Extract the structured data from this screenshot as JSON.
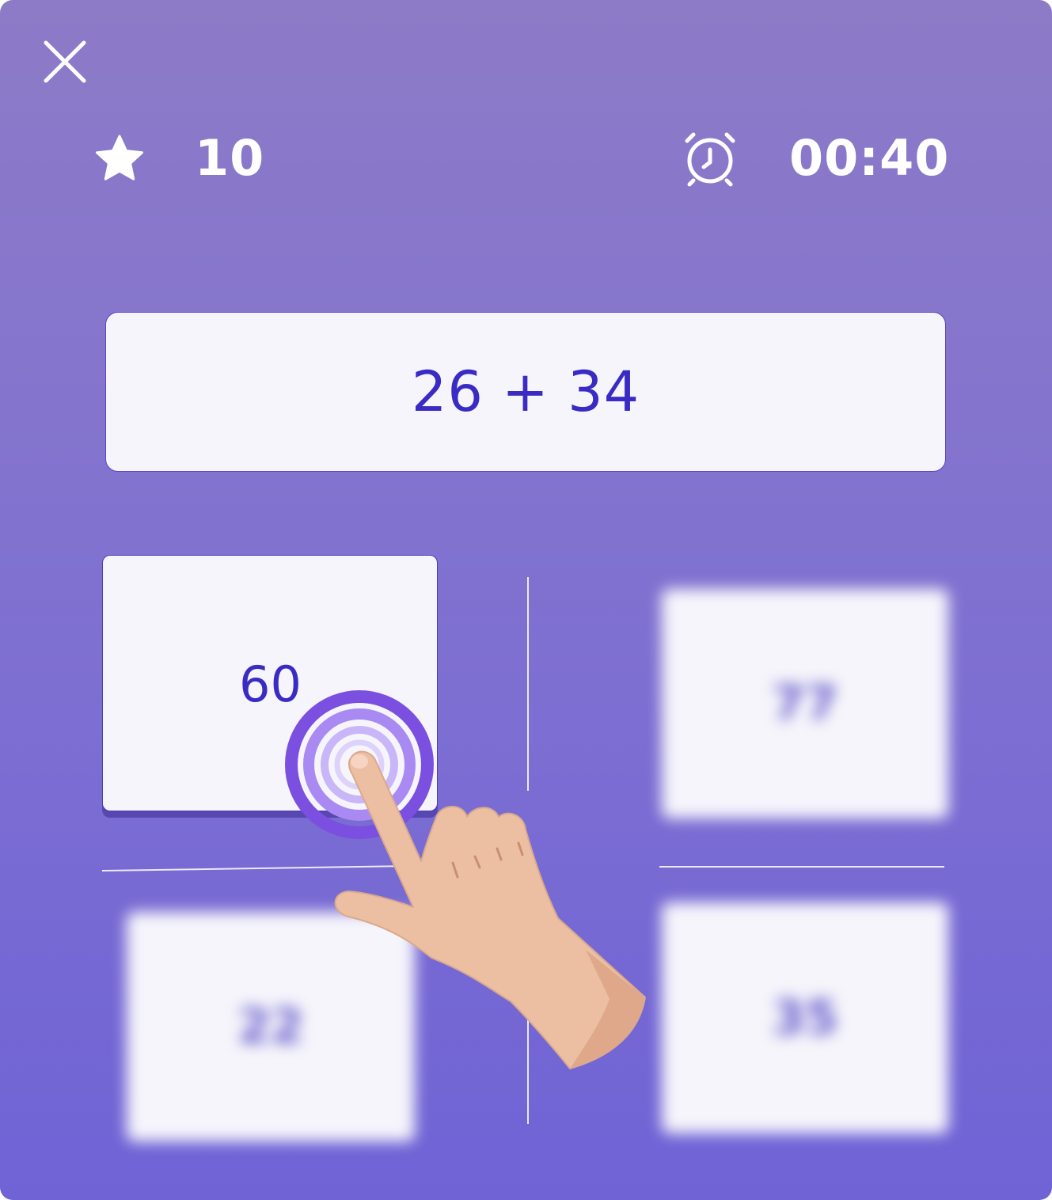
{
  "header": {
    "close_icon": "close-icon",
    "score": {
      "icon": "star-icon",
      "value": "10"
    },
    "timer": {
      "icon": "alarm-clock-icon",
      "value": "00:40"
    }
  },
  "question": {
    "expression": "26 + 34"
  },
  "answers": {
    "selected": {
      "value": "60",
      "state": "tapped"
    },
    "top_right": {
      "value": "77",
      "state": "blurred"
    },
    "bottom_left": {
      "value": "22",
      "state": "blurred"
    },
    "bottom_right": {
      "value": "35",
      "state": "blurred"
    }
  },
  "overlay": {
    "gesture": "tap-hand-icon"
  },
  "colors": {
    "background_top": "#8d7bc7",
    "background_bottom": "#6f63d6",
    "card": "#f6f5fb",
    "text_accent": "#3a2bc4",
    "tap_ring": "#7b4fe0"
  }
}
